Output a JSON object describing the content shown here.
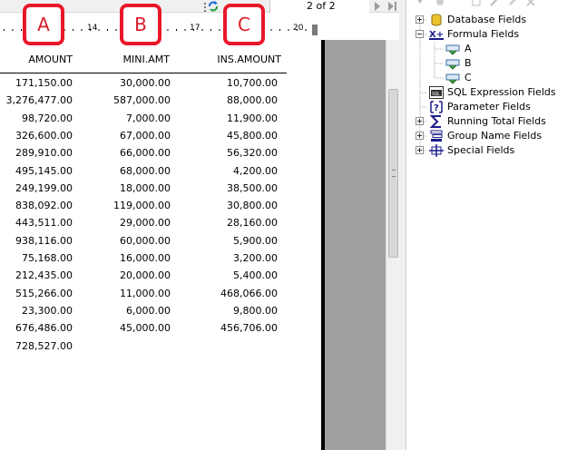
{
  "viewer": {
    "page_indicator": "2 of 2",
    "ruler": {
      "labels": [
        "14",
        "17",
        "20"
      ]
    },
    "report": {
      "columns": [
        {
          "header": "AMOUNT",
          "rows": [
            "171,150.00",
            "3,276,477.00",
            "98,720.00",
            "326,600.00",
            "289,910.00",
            "495,145.00",
            "249,199.00",
            "838,092.00",
            "443,511.00",
            "938,116.00",
            "75,168.00",
            "212,435.00",
            "515,266.00",
            "23,300.00",
            "676,486.00",
            "728,527.00"
          ]
        },
        {
          "header": "MINI.AMT",
          "rows": [
            "30,000.00",
            "587,000.00",
            "7,000.00",
            "67,000.00",
            "66,000.00",
            "68,000.00",
            "18,000.00",
            "119,000.00",
            "29,000.00",
            "60,000.00",
            "16,000.00",
            "20,000.00",
            "11,000.00",
            "6,000.00",
            "45,000.00",
            ""
          ]
        },
        {
          "header": "INS.AMOUNT",
          "rows": [
            "10,700.00",
            "88,000.00",
            "11,900.00",
            "45,800.00",
            "56,320.00",
            "4,200.00",
            "38,500.00",
            "30,800.00",
            "28,160.00",
            "5,900.00",
            "3,200.00",
            "5,400.00",
            "468,066.00",
            "9,800.00",
            "456,706.00",
            ""
          ]
        }
      ]
    },
    "badges": [
      "A",
      "B",
      "C"
    ],
    "accent_color": "#e8182a"
  },
  "field_explorer": {
    "items": [
      {
        "label": "Database Fields",
        "icon": "database-icon",
        "expander": "plus"
      },
      {
        "label": "Formula Fields",
        "icon": "formula-icon",
        "expander": "minus"
      },
      {
        "label": "A",
        "icon": "formula-field-icon"
      },
      {
        "label": "B",
        "icon": "formula-field-icon"
      },
      {
        "label": "C",
        "icon": "formula-field-icon"
      },
      {
        "label": "SQL Expression Fields",
        "icon": "sql-icon"
      },
      {
        "label": "Parameter Fields",
        "icon": "parameter-icon"
      },
      {
        "label": "Running Total Fields",
        "icon": "sigma-icon",
        "expander": "plus"
      },
      {
        "label": "Group Name Fields",
        "icon": "group-icon",
        "expander": "plus"
      },
      {
        "label": "Special Fields",
        "icon": "special-icon",
        "expander": "plus"
      }
    ]
  }
}
